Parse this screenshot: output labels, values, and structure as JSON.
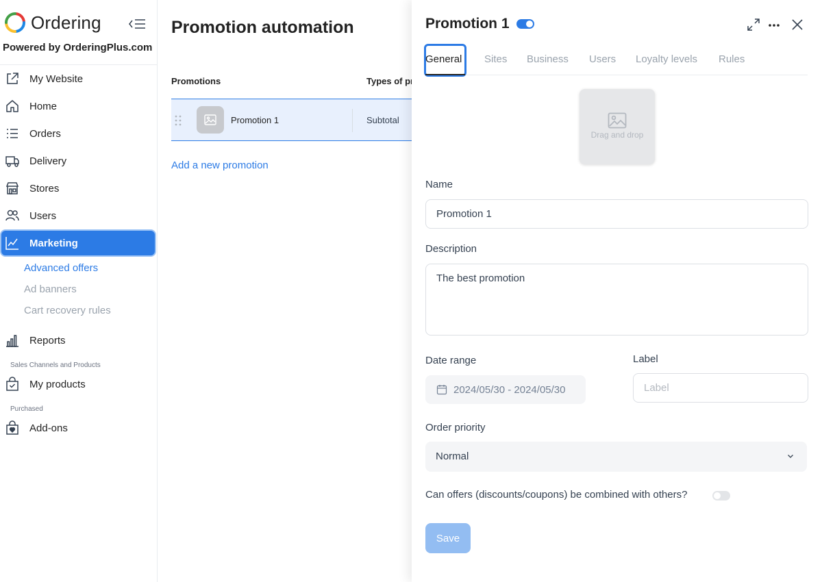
{
  "brand": {
    "name": "Ordering",
    "powered_by": "Powered by OrderingPlus.com",
    "logo_colors": [
      "#E53935",
      "#43A047",
      "#FBC02D",
      "#1E88E5"
    ]
  },
  "sidebar": {
    "items": [
      {
        "label": "My Website",
        "icon": "external-link-icon"
      },
      {
        "label": "Home",
        "icon": "home-icon"
      },
      {
        "label": "Orders",
        "icon": "list-icon"
      },
      {
        "label": "Delivery",
        "icon": "truck-icon"
      },
      {
        "label": "Stores",
        "icon": "shop-icon"
      },
      {
        "label": "Users",
        "icon": "users-icon"
      },
      {
        "label": "Marketing",
        "icon": "chart-line-icon",
        "active": true
      },
      {
        "label": "Reports",
        "icon": "bar-chart-icon"
      },
      {
        "label": "My products",
        "icon": "bag-check-icon"
      },
      {
        "label": "Add-ons",
        "icon": "bag-heart-icon"
      }
    ],
    "marketing_sub": [
      "Advanced offers",
      "Ad banners",
      "Cart recovery rules"
    ],
    "sections": [
      "Sales Channels and Products",
      "Purchased"
    ]
  },
  "main": {
    "title": "Promotion automation",
    "columns": [
      "Promotions",
      "Types of pr"
    ],
    "rows": [
      {
        "name": "Promotion 1",
        "type": "Subtotal"
      }
    ],
    "add_link": "Add a new promotion"
  },
  "panel": {
    "title": "Promotion 1",
    "enabled": true,
    "tabs": [
      "General",
      "Sites",
      "Business",
      "Users",
      "Loyalty levels",
      "Rules"
    ],
    "active_tab": "General",
    "dropzone_text": "Drag and drop",
    "name_label": "Name",
    "name_value": "Promotion 1",
    "description_label": "Description",
    "description_value": "The best promotion",
    "date_label": "Date range",
    "date_value": "2024/05/30 - 2024/05/30",
    "label_label": "Label",
    "label_placeholder": "Label",
    "priority_label": "Order priority",
    "priority_value": "Normal",
    "combine_label": "Can offers (discounts/coupons) be combined with others?",
    "combine_enabled": false,
    "save_label": "Save"
  },
  "colors": {
    "accent": "#2C7BE5",
    "save_disabled": "#93bdf2",
    "row_highlight": "#e8f0fd"
  }
}
